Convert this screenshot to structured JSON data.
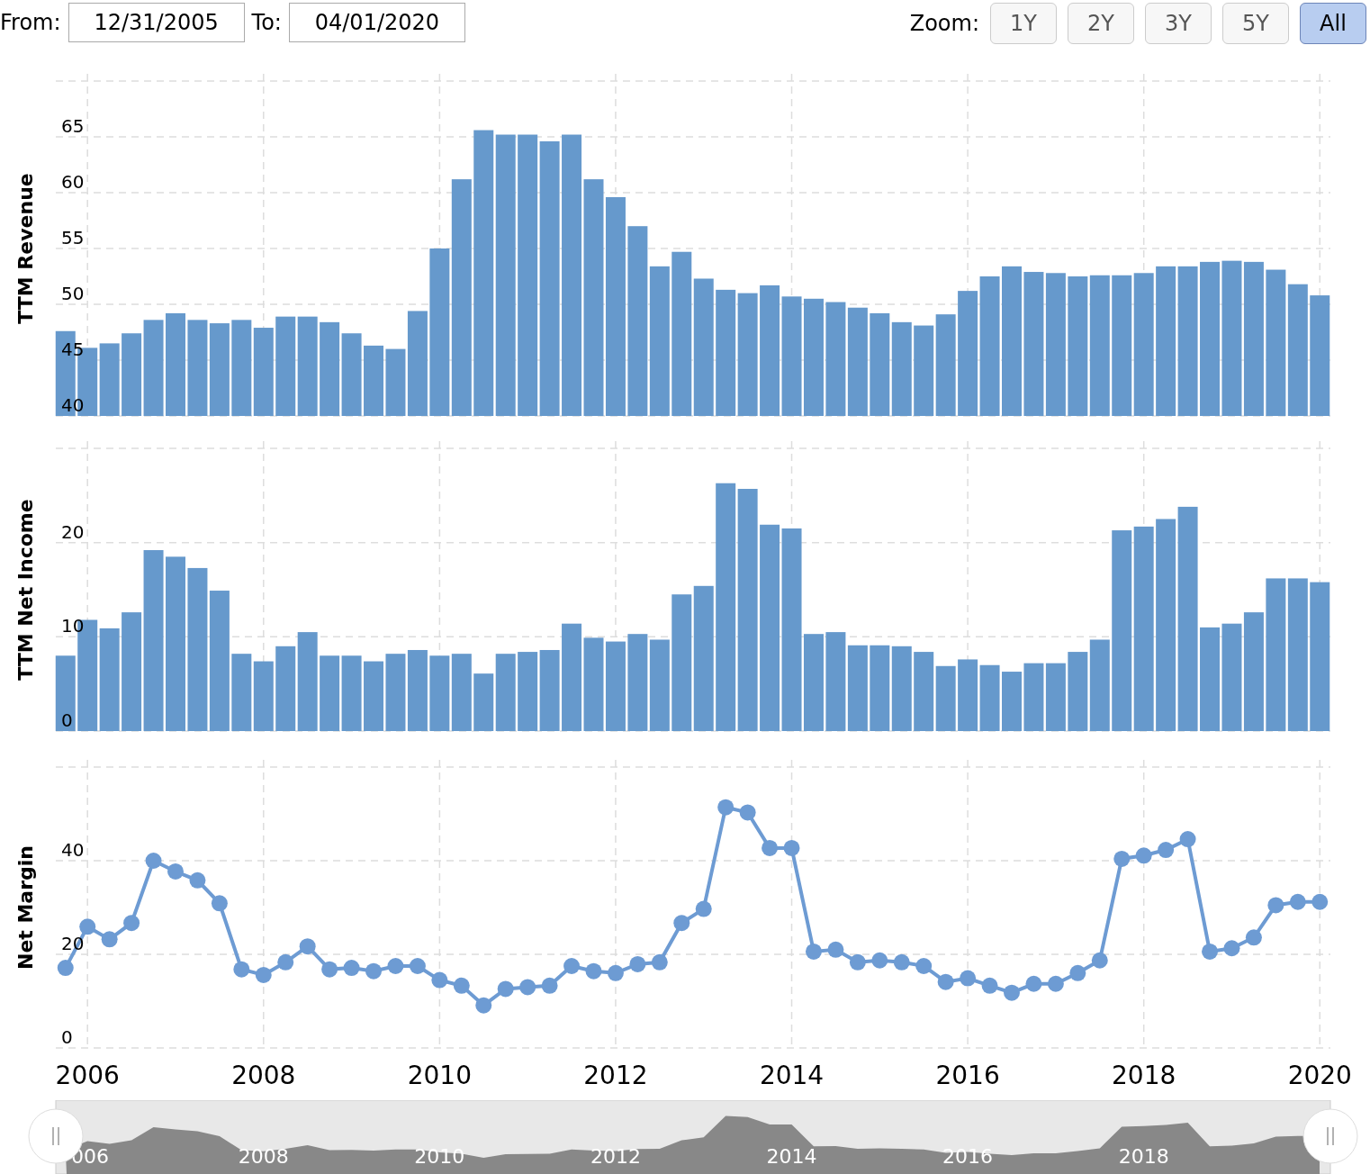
{
  "range": {
    "from_label": "From:",
    "from": "12/31/2005",
    "to_label": "To:",
    "to": "04/01/2020"
  },
  "zoom": {
    "label": "Zoom:",
    "buttons": [
      {
        "label": "1Y",
        "selected": false
      },
      {
        "label": "2Y",
        "selected": false
      },
      {
        "label": "3Y",
        "selected": false
      },
      {
        "label": "5Y",
        "selected": false
      },
      {
        "label": "All",
        "selected": true
      }
    ]
  },
  "panels": [
    {
      "chart_data": {
        "type": "bar",
        "ylabel": "TTM Revenue",
        "x": [
          2005.75,
          2006,
          2006.25,
          2006.5,
          2006.75,
          2007,
          2007.25,
          2007.5,
          2007.75,
          2008,
          2008.25,
          2008.5,
          2008.75,
          2009,
          2009.25,
          2009.5,
          2009.75,
          2010,
          2010.25,
          2010.5,
          2010.75,
          2011,
          2011.25,
          2011.5,
          2011.75,
          2012,
          2012.25,
          2012.5,
          2012.75,
          2013,
          2013.25,
          2013.5,
          2013.75,
          2014,
          2014.25,
          2014.5,
          2014.75,
          2015,
          2015.25,
          2015.5,
          2015.75,
          2016,
          2016.25,
          2016.5,
          2016.75,
          2017,
          2017.25,
          2017.5,
          2017.75,
          2018,
          2018.25,
          2018.5,
          2018.75,
          2019,
          2019.25,
          2019.5,
          2019.75,
          2020
        ],
        "grid": true,
        "series": [
          {
            "color": "#6699cc",
            "values": [
              47.6,
              46.1,
              46.5,
              47.4,
              48.6,
              49.2,
              48.6,
              48.3,
              48.6,
              47.9,
              48.9,
              48.9,
              48.4,
              47.4,
              46.3,
              46.0,
              49.4,
              55.0,
              61.2,
              65.6,
              65.2,
              65.2,
              64.6,
              65.2,
              61.2,
              59.6,
              57.0,
              53.4,
              54.7,
              52.3,
              51.3,
              51.0,
              51.7,
              50.7,
              50.5,
              50.2,
              49.7,
              49.2,
              48.4,
              48.1,
              49.1,
              51.2,
              52.5,
              53.4,
              52.9,
              52.8,
              52.5,
              52.6,
              52.6,
              52.8,
              53.4,
              53.4,
              53.8,
              53.9,
              53.8,
              53.1,
              51.8,
              50.8
            ]
          }
        ],
        "xlim": [
          2005.64,
          2020.12
        ],
        "ylim": [
          40,
          70
        ],
        "yticks": [
          40,
          45,
          50,
          55,
          60,
          65
        ]
      }
    },
    {
      "chart_data": {
        "type": "bar",
        "ylabel": "TTM Net Income",
        "x": [
          2005.75,
          2006,
          2006.25,
          2006.5,
          2006.75,
          2007,
          2007.25,
          2007.5,
          2007.75,
          2008,
          2008.25,
          2008.5,
          2008.75,
          2009,
          2009.25,
          2009.5,
          2009.75,
          2010,
          2010.25,
          2010.5,
          2010.75,
          2011,
          2011.25,
          2011.5,
          2011.75,
          2012,
          2012.25,
          2012.5,
          2012.75,
          2013,
          2013.25,
          2013.5,
          2013.75,
          2014,
          2014.25,
          2014.5,
          2014.75,
          2015,
          2015.25,
          2015.5,
          2015.75,
          2016,
          2016.25,
          2016.5,
          2016.75,
          2017,
          2017.25,
          2017.5,
          2017.75,
          2018,
          2018.25,
          2018.5,
          2018.75,
          2019,
          2019.25,
          2019.5,
          2019.75,
          2020
        ],
        "grid": true,
        "series": [
          {
            "color": "#6699cc",
            "values": [
              8.0,
              11.8,
              10.9,
              12.6,
              19.2,
              18.5,
              17.3,
              14.9,
              8.2,
              7.4,
              9.0,
              10.5,
              8.0,
              8.0,
              7.4,
              8.2,
              8.6,
              8.0,
              8.2,
              6.1,
              8.2,
              8.4,
              8.6,
              11.4,
              9.9,
              9.5,
              10.3,
              9.7,
              14.5,
              15.4,
              26.3,
              25.7,
              21.9,
              21.5,
              10.3,
              10.5,
              9.1,
              9.1,
              9.0,
              8.4,
              6.9,
              7.6,
              7.0,
              6.3,
              7.2,
              7.2,
              8.4,
              9.7,
              21.3,
              21.7,
              22.5,
              23.8,
              11.0,
              11.4,
              12.6,
              16.2,
              16.2,
              15.8
            ]
          }
        ],
        "xlim": [
          2005.64,
          2020.12
        ],
        "ylim": [
          0,
          30
        ],
        "yticks": [
          0,
          10,
          20
        ]
      }
    },
    {
      "chart_data": {
        "type": "line",
        "ylabel": "Net Margin",
        "x": [
          2005.75,
          2006,
          2006.25,
          2006.5,
          2006.75,
          2007,
          2007.25,
          2007.5,
          2007.75,
          2008,
          2008.25,
          2008.5,
          2008.75,
          2009,
          2009.25,
          2009.5,
          2009.75,
          2010,
          2010.25,
          2010.5,
          2010.75,
          2011,
          2011.25,
          2011.5,
          2011.75,
          2012,
          2012.25,
          2012.5,
          2012.75,
          2013,
          2013.25,
          2013.5,
          2013.75,
          2014,
          2014.25,
          2014.5,
          2014.75,
          2015,
          2015.25,
          2015.5,
          2015.75,
          2016,
          2016.25,
          2016.5,
          2016.75,
          2017,
          2017.25,
          2017.5,
          2017.75,
          2018,
          2018.25,
          2018.5,
          2018.75,
          2019,
          2019.25,
          2019.5,
          2019.75,
          2020
        ],
        "grid": true,
        "series": [
          {
            "color": "#6d9bd3",
            "marker": true,
            "values": [
              17.1,
              25.9,
              23.2,
              26.7,
              40.0,
              37.7,
              35.8,
              30.9,
              16.8,
              15.6,
              18.3,
              21.7,
              16.8,
              17.1,
              16.4,
              17.5,
              17.5,
              14.5,
              13.3,
              9.1,
              12.6,
              13.0,
              13.3,
              17.5,
              16.4,
              16.0,
              17.9,
              18.3,
              26.7,
              29.7,
              51.4,
              50.3,
              42.7,
              42.7,
              20.6,
              21.0,
              18.3,
              18.7,
              18.3,
              17.5,
              14.1,
              14.9,
              13.3,
              11.8,
              13.7,
              13.7,
              16.0,
              18.7,
              40.4,
              41.1,
              42.3,
              44.6,
              20.6,
              21.3,
              23.6,
              30.5,
              31.2,
              31.2
            ]
          }
        ],
        "xlim": [
          2005.64,
          2020.12
        ],
        "ylim": [
          0,
          60
        ],
        "yticks": [
          0,
          20,
          40
        ],
        "xticks": [
          2006,
          2008,
          2010,
          2012,
          2014,
          2016,
          2018,
          2020
        ]
      }
    }
  ],
  "navigator": {
    "labels": [
      "006",
      "2008",
      "2010",
      "2012",
      "2014",
      "2016",
      "2018"
    ]
  }
}
